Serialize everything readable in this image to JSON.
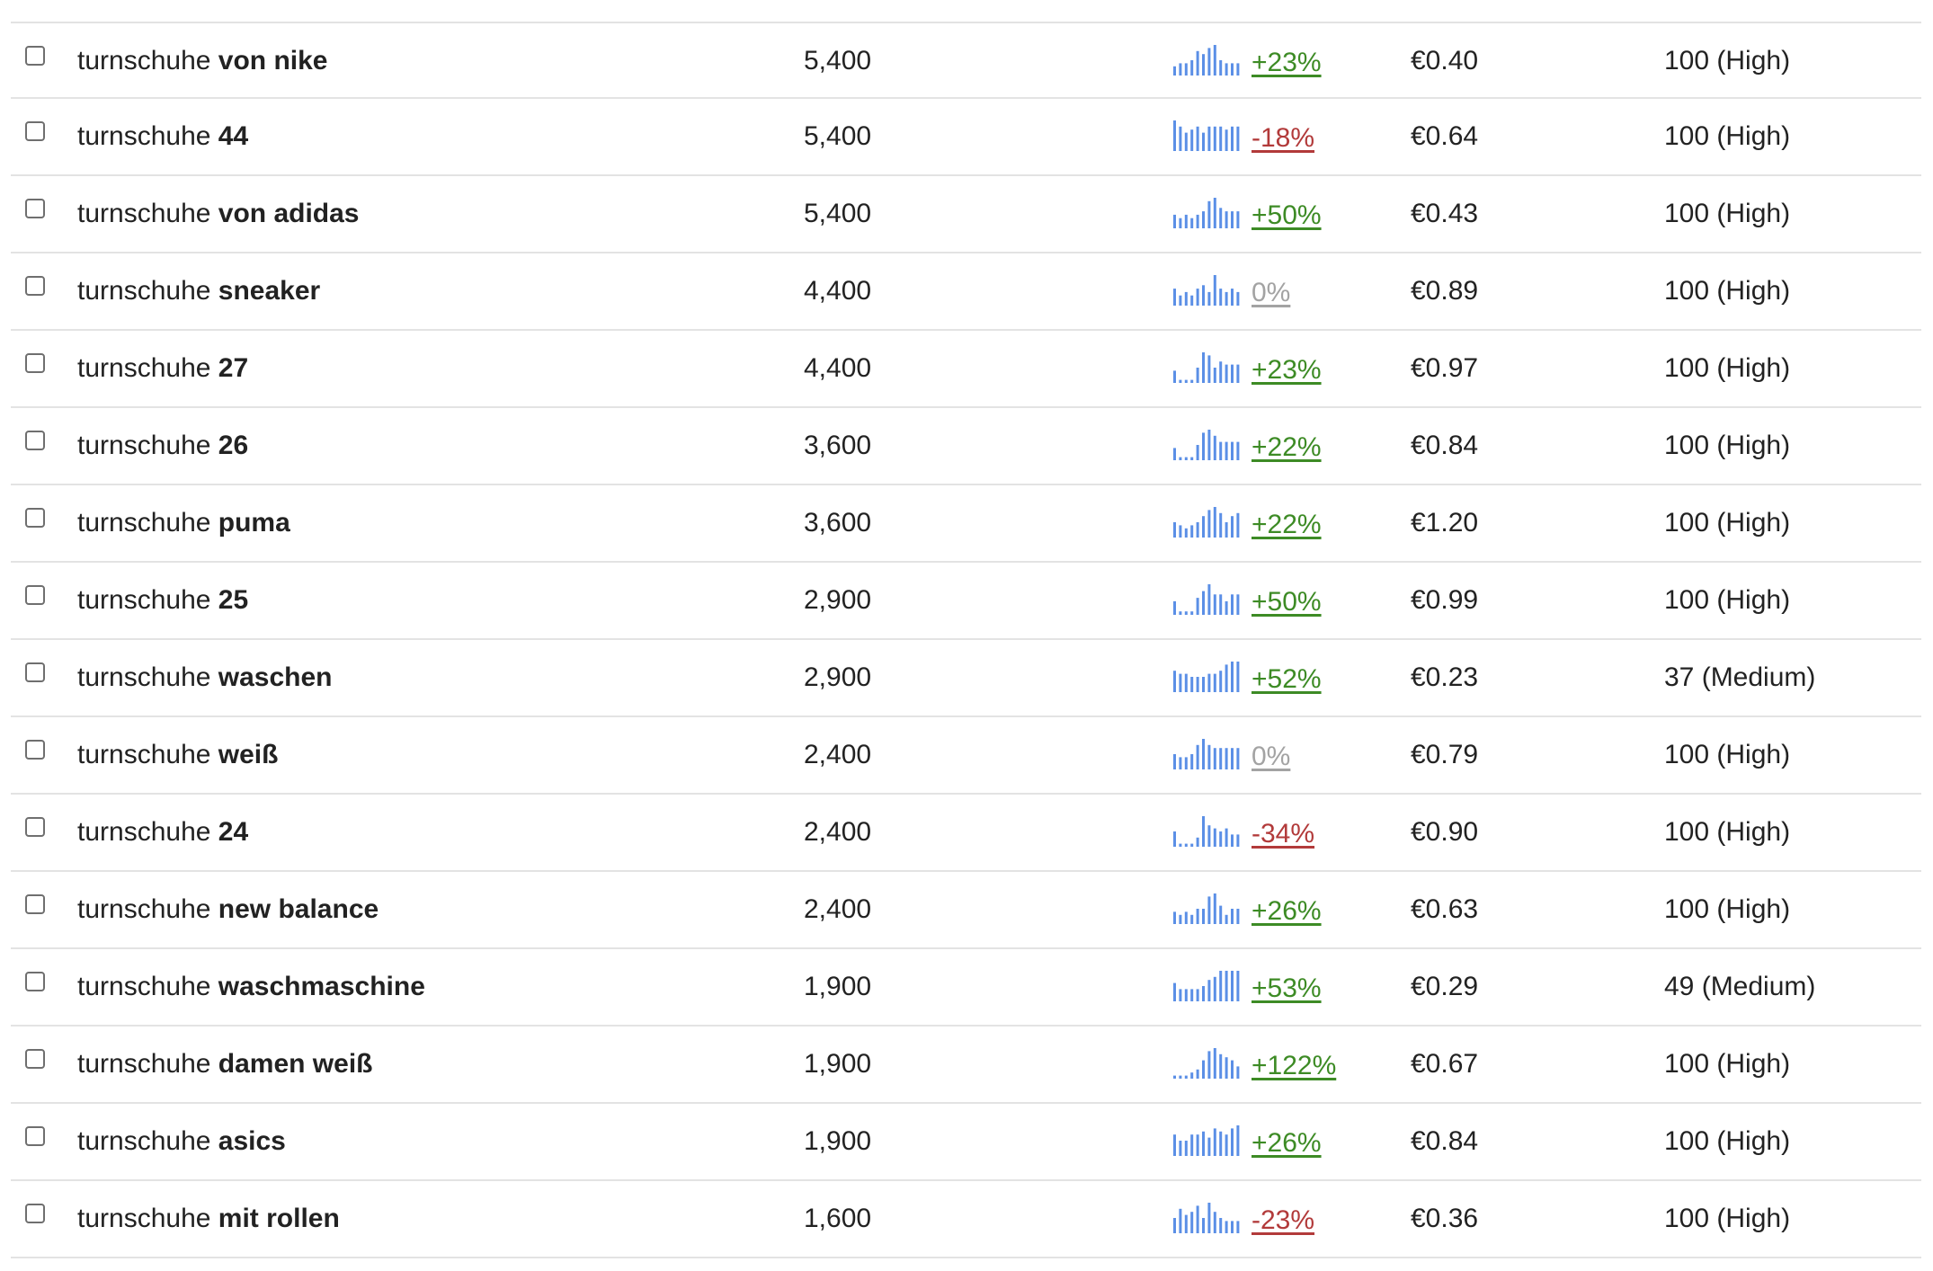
{
  "keyword_prefix": "turnschuhe",
  "colors": {
    "trend_bar": "#5b8fe6",
    "positive": "#3d8b25",
    "negative": "#b23a3a",
    "neutral": "#a3a3a3"
  },
  "rows": [
    {
      "suffix": "von nike",
      "volume": "5,400",
      "trend": [
        3,
        4,
        4,
        5,
        8,
        7,
        9,
        10,
        5,
        4,
        4,
        4
      ],
      "change": "+23%",
      "change_type": "pos",
      "cpc": "€0.40",
      "difficulty": "100 (High)"
    },
    {
      "suffix": "44",
      "volume": "5,400",
      "trend": [
        10,
        8,
        6,
        7,
        8,
        6,
        8,
        8,
        8,
        7,
        8,
        8
      ],
      "change": "-18%",
      "change_type": "neg",
      "cpc": "€0.64",
      "difficulty": "100 (High)"
    },
    {
      "suffix": "von adidas",
      "volume": "5,400",
      "trend": [
        4,
        3,
        4,
        3,
        4,
        5,
        8,
        9,
        6,
        5,
        5,
        5
      ],
      "change": "+50%",
      "change_type": "pos",
      "cpc": "€0.43",
      "difficulty": "100 (High)"
    },
    {
      "suffix": "sneaker",
      "volume": "4,400",
      "trend": [
        5,
        3,
        4,
        3,
        5,
        6,
        4,
        9,
        5,
        4,
        5,
        4
      ],
      "change": "0%",
      "change_type": "zero",
      "cpc": "€0.89",
      "difficulty": "100 (High)"
    },
    {
      "suffix": "27",
      "volume": "4,400",
      "trend": [
        4,
        1,
        1,
        1,
        5,
        10,
        9,
        5,
        7,
        6,
        6,
        6
      ],
      "change": "+23%",
      "change_type": "pos",
      "cpc": "€0.97",
      "difficulty": "100 (High)"
    },
    {
      "suffix": "26",
      "volume": "3,600",
      "trend": [
        4,
        1,
        1,
        1,
        5,
        9,
        10,
        8,
        6,
        6,
        6,
        6
      ],
      "change": "+22%",
      "change_type": "pos",
      "cpc": "€0.84",
      "difficulty": "100 (High)"
    },
    {
      "suffix": "puma",
      "volume": "3,600",
      "trend": [
        5,
        4,
        3,
        4,
        5,
        7,
        9,
        10,
        8,
        5,
        7,
        8
      ],
      "change": "+22%",
      "change_type": "pos",
      "cpc": "€1.20",
      "difficulty": "100 (High)"
    },
    {
      "suffix": "25",
      "volume": "2,900",
      "trend": [
        4,
        1,
        1,
        1,
        5,
        7,
        9,
        6,
        6,
        4,
        6,
        6
      ],
      "change": "+50%",
      "change_type": "pos",
      "cpc": "€0.99",
      "difficulty": "100 (High)"
    },
    {
      "suffix": "waschen",
      "volume": "2,900",
      "trend": [
        7,
        6,
        6,
        5,
        5,
        5,
        6,
        6,
        7,
        9,
        10,
        10
      ],
      "change": "+52%",
      "change_type": "pos",
      "cpc": "€0.23",
      "difficulty": "37 (Medium)"
    },
    {
      "suffix": "weiß",
      "volume": "2,400",
      "trend": [
        5,
        4,
        4,
        5,
        8,
        10,
        8,
        7,
        7,
        7,
        7,
        7
      ],
      "change": "0%",
      "change_type": "zero",
      "cpc": "€0.79",
      "difficulty": "100 (High)"
    },
    {
      "suffix": "24",
      "volume": "2,400",
      "trend": [
        5,
        1,
        1,
        1,
        3,
        10,
        7,
        6,
        5,
        6,
        4,
        4
      ],
      "change": "-34%",
      "change_type": "neg",
      "cpc": "€0.90",
      "difficulty": "100 (High)"
    },
    {
      "suffix": "new balance",
      "volume": "2,400",
      "trend": [
        4,
        3,
        4,
        3,
        5,
        5,
        9,
        10,
        6,
        3,
        5,
        5
      ],
      "change": "+26%",
      "change_type": "pos",
      "cpc": "€0.63",
      "difficulty": "100 (High)"
    },
    {
      "suffix": "waschmaschine",
      "volume": "1,900",
      "trend": [
        6,
        4,
        4,
        4,
        4,
        5,
        7,
        8,
        10,
        10,
        10,
        10
      ],
      "change": "+53%",
      "change_type": "pos",
      "cpc": "€0.29",
      "difficulty": "49 (Medium)"
    },
    {
      "suffix": "damen weiß",
      "volume": "1,900",
      "trend": [
        1,
        1,
        1,
        2,
        3,
        6,
        9,
        10,
        8,
        7,
        6,
        4
      ],
      "change": "+122%",
      "change_type": "pos",
      "cpc": "€0.67",
      "difficulty": "100 (High)"
    },
    {
      "suffix": "asics",
      "volume": "1,900",
      "trend": [
        7,
        5,
        5,
        7,
        7,
        8,
        6,
        9,
        8,
        7,
        9,
        10
      ],
      "change": "+26%",
      "change_type": "pos",
      "cpc": "€0.84",
      "difficulty": "100 (High)"
    },
    {
      "suffix": "mit rollen",
      "volume": "1,600",
      "trend": [
        5,
        8,
        6,
        7,
        9,
        5,
        10,
        7,
        5,
        4,
        4,
        4
      ],
      "change": "-23%",
      "change_type": "neg",
      "cpc": "€0.36",
      "difficulty": "100 (High)"
    }
  ]
}
